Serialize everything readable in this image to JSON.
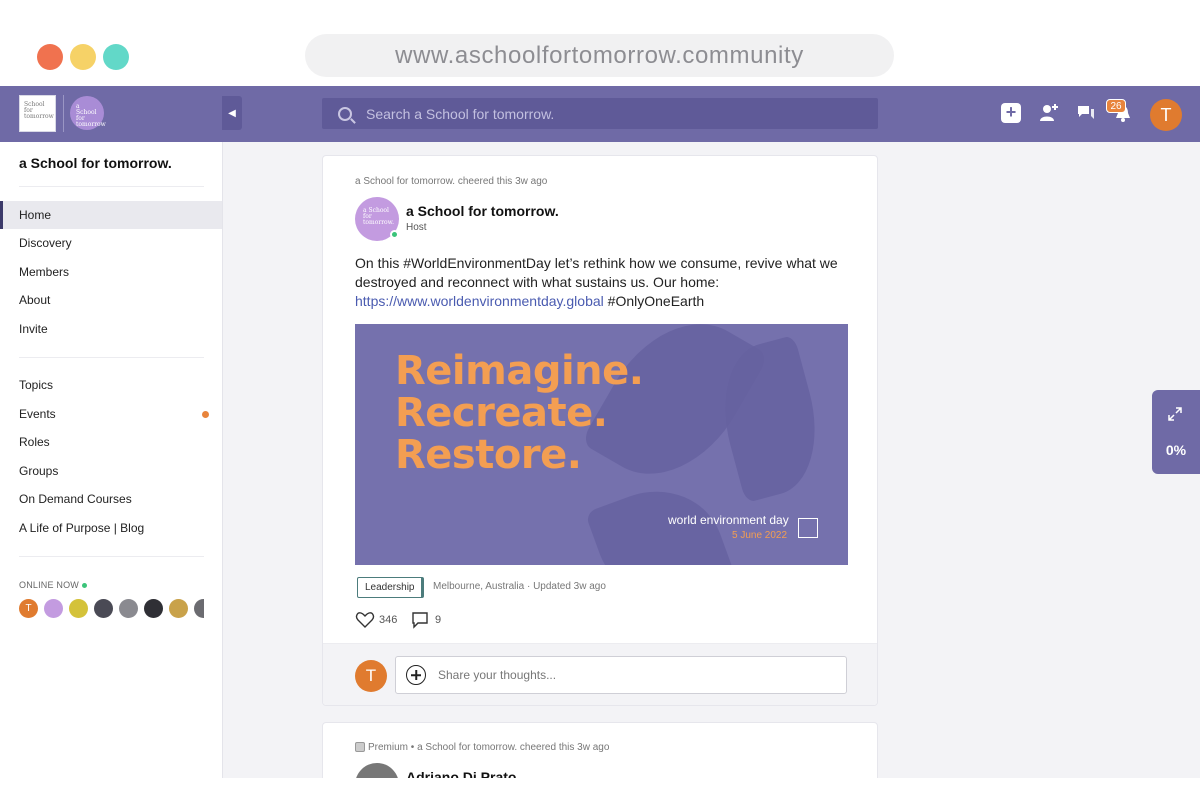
{
  "browser": {
    "url": "www.aschoolfortomorrow.community",
    "traffic_colors": [
      "#f0724f",
      "#f6d267",
      "#62d8c8"
    ]
  },
  "topbar": {
    "logo_text": "School for tomorrow",
    "logo2_text": "a School for tomorrow",
    "search_placeholder": "Search a School for tomorrow.",
    "notifications_count": "26",
    "user_initial": "T",
    "accent_color": "#6f6aa6"
  },
  "sidebar": {
    "community_name": "a School for tomorrow.",
    "nav_primary": [
      "Home",
      "Discovery",
      "Members",
      "About",
      "Invite"
    ],
    "nav_secondary": [
      "Topics",
      "Events",
      "Roles",
      "Groups",
      "On Demand Courses",
      "A Life of Purpose | Blog"
    ],
    "online_label": "ONLINE NOW",
    "online_avatars": [
      "T",
      "",
      "",
      "",
      "",
      "",
      "",
      ""
    ]
  },
  "post": {
    "activity": "a School for tomorrow. cheered this 3w ago",
    "avatar_text": "a School for tomorrow.",
    "author": "a School for tomorrow.",
    "role": "Host",
    "text_part1": "On this #WorldEnvironmentDay let’s rethink how we consume, revive what we destroyed and reconnect with what sustains us. Our home:",
    "link": "https://www.worldenvironmentday.global",
    "text_part2": "#OnlyOneEarth",
    "image": {
      "line1": "Reimagine.",
      "line2": "Recreate.",
      "line3": "Restore.",
      "brand": "world environment day",
      "date": "5 June 2022"
    },
    "tag": "Leadership",
    "location": "Melbourne, Australia",
    "separator": "·",
    "updated": "Updated 3w ago",
    "likes": "346",
    "comments": "9",
    "compose_placeholder": "Share your thoughts...",
    "compose_initial": "T"
  },
  "post2": {
    "premium": "Premium",
    "bullet": "•",
    "activity": "a School for tomorrow. cheered this 3w ago",
    "author": "Adriano Di Prato"
  },
  "widget": {
    "progress": "0%"
  }
}
